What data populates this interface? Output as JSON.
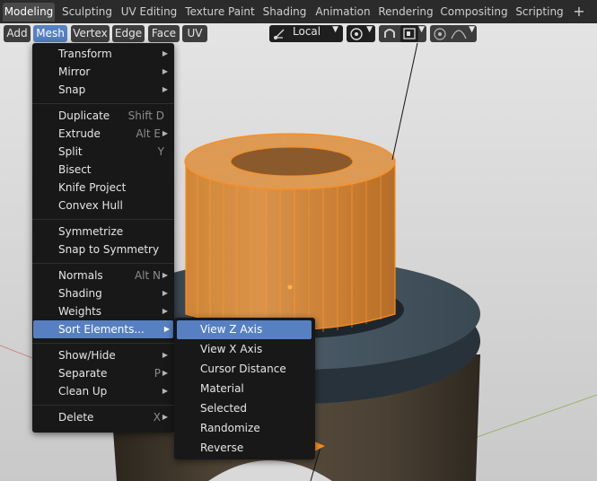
{
  "workspace_tabs": [
    {
      "label": "Modeling",
      "active": true
    },
    {
      "label": "Sculpting"
    },
    {
      "label": "UV Editing"
    },
    {
      "label": "Texture Paint"
    },
    {
      "label": "Shading"
    },
    {
      "label": "Animation"
    },
    {
      "label": "Rendering"
    },
    {
      "label": "Compositing"
    },
    {
      "label": "Scripting"
    }
  ],
  "add_tab_symbol": "+",
  "header_menus": [
    "Add",
    "Mesh",
    "Vertex",
    "Edge",
    "Face",
    "UV"
  ],
  "transform_orientation": "Local",
  "mesh_menu": {
    "items": [
      {
        "label": "Transform",
        "submenu": true
      },
      {
        "label": "Mirror",
        "submenu": true
      },
      {
        "label": "Snap",
        "submenu": true
      },
      {
        "label": "Duplicate",
        "shortcut": "Shift D"
      },
      {
        "label": "Extrude",
        "shortcut": "Alt E",
        "submenu": true
      },
      {
        "label": "Split",
        "shortcut": "Y"
      },
      {
        "label": "Bisect"
      },
      {
        "label": "Knife Project"
      },
      {
        "label": "Convex Hull"
      },
      {
        "label": "Symmetrize"
      },
      {
        "label": "Snap to Symmetry"
      },
      {
        "label": "Normals",
        "shortcut": "Alt N",
        "submenu": true
      },
      {
        "label": "Shading",
        "submenu": true
      },
      {
        "label": "Weights",
        "submenu": true
      },
      {
        "label": "Sort Elements...",
        "submenu": true,
        "highlighted": true
      },
      {
        "label": "Show/Hide",
        "submenu": true
      },
      {
        "label": "Separate",
        "shortcut": "P",
        "submenu": true
      },
      {
        "label": "Clean Up",
        "submenu": true
      },
      {
        "label": "Delete",
        "shortcut": "X",
        "submenu": true
      }
    ]
  },
  "sort_menu": {
    "items": [
      {
        "label": "View Z Axis",
        "highlighted": true
      },
      {
        "label": "View X Axis"
      },
      {
        "label": "Cursor Distance"
      },
      {
        "label": "Material"
      },
      {
        "label": "Selected"
      },
      {
        "label": "Randomize"
      },
      {
        "label": "Reverse"
      }
    ]
  },
  "colors": {
    "accent": "#5680c2",
    "menu_bg": "#181818",
    "selection_orange": "#ff8c1a",
    "viewport_bg": "#d5d5d5"
  }
}
